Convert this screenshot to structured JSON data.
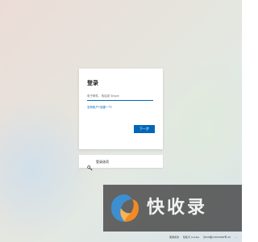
{
  "login_card": {
    "title": "登录",
    "input_placeholder": "电子邮件、电话或 Skype",
    "no_account_link": "没有帐户?创建一个!",
    "next_button": "下一步"
  },
  "signin_options": {
    "label": "登录选项",
    "icon": "key-icon"
  },
  "watermark": {
    "text": "快收录"
  },
  "footer": {
    "terms": "使用条款",
    "privacy": "隐私与 Cookie",
    "icp": "沪ICP备13015306号-25",
    "more": "..."
  },
  "colors": {
    "accent": "#0067b8",
    "card_bg": "#ffffff",
    "text": "#1b1b1b"
  }
}
